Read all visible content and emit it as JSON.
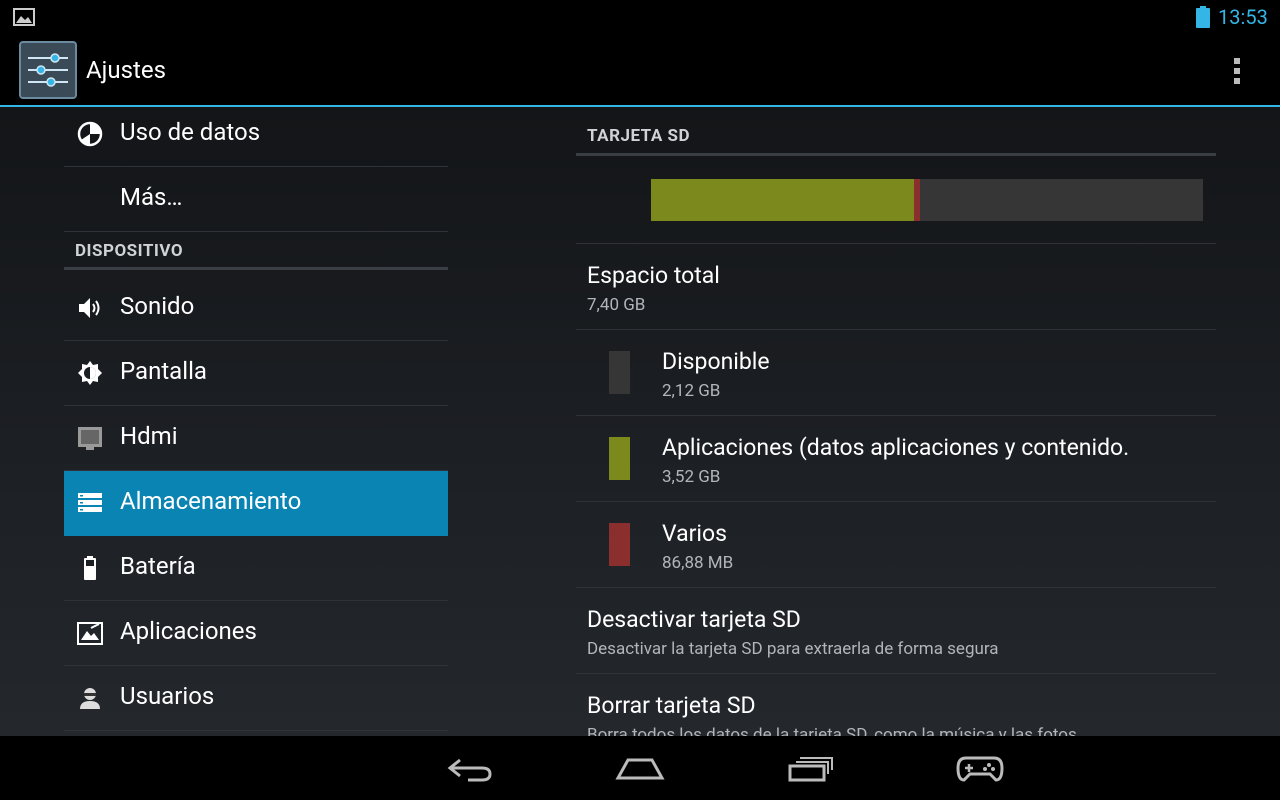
{
  "status_bar": {
    "time": "13:53",
    "accent_color": "#33b5e5"
  },
  "action_bar": {
    "title": "Ajustes",
    "app_icon": "settings-sliders-icon",
    "overflow_icon": "overflow-menu-icon"
  },
  "menu": {
    "top_items": [
      {
        "label": "Uso de datos",
        "icon": "data-usage-icon"
      },
      {
        "label": "Más…",
        "icon": ""
      }
    ],
    "section_header": "DISPOSITIVO",
    "device_items": [
      {
        "label": "Sonido",
        "icon": "speaker-icon"
      },
      {
        "label": "Pantalla",
        "icon": "brightness-icon"
      },
      {
        "label": "Hdmi",
        "icon": "hdmi-icon"
      },
      {
        "label": "Almacenamiento",
        "icon": "storage-icon",
        "active": true
      },
      {
        "label": "Batería",
        "icon": "battery-icon"
      },
      {
        "label": "Aplicaciones",
        "icon": "apps-icon"
      },
      {
        "label": "Usuarios",
        "icon": "user-icon"
      }
    ],
    "active_color": "#0a84b3"
  },
  "detail": {
    "header": "TARJETA SD",
    "usage_bar": {
      "total_gb": 7.4,
      "segments": [
        {
          "name": "Aplicaciones",
          "fraction": 0.476,
          "color": "#7c8a1d"
        },
        {
          "name": "Varios",
          "fraction": 0.0117,
          "color": "#8b2e2e"
        },
        {
          "name": "Disponible",
          "fraction": 0.512,
          "color": "#363636"
        }
      ]
    },
    "total": {
      "title": "Espacio total",
      "value": "7,40 GB"
    },
    "categories": [
      {
        "title": "Disponible",
        "value": "2,12 GB",
        "color": "#363636"
      },
      {
        "title": "Aplicaciones (datos aplicaciones y contenido.",
        "value": "3,52 GB",
        "color": "#7c8a1d"
      },
      {
        "title": "Varios",
        "value": "86,88 MB",
        "color": "#8b2e2e"
      }
    ],
    "unmount": {
      "title": "Desactivar tarjeta SD",
      "subtitle": "Desactivar la tarjeta SD para extraerla de forma segura"
    },
    "erase": {
      "title": "Borrar tarjeta SD",
      "subtitle": "Borra todos los datos de la tarjeta SD, como la música y las fotos"
    }
  },
  "nav_bar": {
    "buttons": [
      "back-icon",
      "home-icon",
      "recent-apps-icon",
      "gamepad-icon"
    ]
  }
}
